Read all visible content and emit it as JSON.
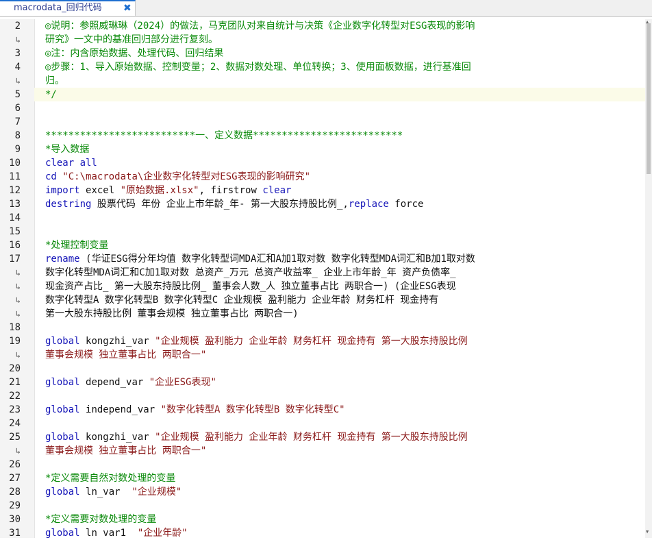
{
  "tab": {
    "title": "macrodata_回归代码",
    "close": "✖"
  },
  "lines": [
    {
      "no": "2",
      "parts": [
        {
          "t": "c",
          "v": "◎说明：参照威琳琳（2024）的做法，马克团队对来自统计与决策《企业数字化转型对ESG表现的影响"
        }
      ]
    },
    {
      "no": "↳",
      "wrap": true,
      "parts": [
        {
          "t": "c",
          "v": "研究》一文中的基准回归部分进行复刻。"
        }
      ]
    },
    {
      "no": "3",
      "parts": [
        {
          "t": "c",
          "v": "◎注：内含原始数据、处理代码、回归结果"
        }
      ]
    },
    {
      "no": "4",
      "parts": [
        {
          "t": "c",
          "v": "◎步骤：1、导入原始数据、控制变量；2、数据对数处理、单位转换；3、使用面板数据，进行基准回"
        }
      ]
    },
    {
      "no": "↳",
      "wrap": true,
      "parts": [
        {
          "t": "c",
          "v": "归。"
        }
      ]
    },
    {
      "no": "5",
      "parts": [
        {
          "t": "c",
          "v": "*/"
        }
      ]
    },
    {
      "no": "6",
      "parts": []
    },
    {
      "no": "7",
      "parts": []
    },
    {
      "no": "8",
      "parts": [
        {
          "t": "c",
          "v": "**************************一、定义数据**************************"
        }
      ]
    },
    {
      "no": "9",
      "parts": [
        {
          "t": "c",
          "v": "*导入数据"
        }
      ]
    },
    {
      "no": "10",
      "parts": [
        {
          "t": "k",
          "v": "clear all"
        }
      ]
    },
    {
      "no": "11",
      "parts": [
        {
          "t": "k",
          "v": "cd "
        },
        {
          "t": "s",
          "v": "\"C:\\macrodata\\企业数字化转型对ESG表现的影响研究\""
        }
      ]
    },
    {
      "no": "12",
      "parts": [
        {
          "t": "k",
          "v": "import "
        },
        {
          "t": "n",
          "v": "excel "
        },
        {
          "t": "s",
          "v": "\"原始数据.xlsx\""
        },
        {
          "t": "n",
          "v": ", firstrow "
        },
        {
          "t": "k",
          "v": "clear"
        }
      ]
    },
    {
      "no": "13",
      "parts": [
        {
          "t": "k",
          "v": "destring "
        },
        {
          "t": "n",
          "v": "股票代码 年份 企业上市年龄_年- 第一大股东持股比例_,"
        },
        {
          "t": "k",
          "v": "replace"
        },
        {
          "t": "n",
          "v": " force"
        }
      ]
    },
    {
      "no": "14",
      "parts": []
    },
    {
      "no": "15",
      "parts": []
    },
    {
      "no": "16",
      "parts": [
        {
          "t": "c",
          "v": "*处理控制变量"
        }
      ]
    },
    {
      "no": "17",
      "parts": [
        {
          "t": "k",
          "v": "rename "
        },
        {
          "t": "n",
          "v": "(华证ESG得分年均值 数字化转型词MDA汇和A加1取对数 数字化转型MDA词汇和B加1取对数"
        }
      ]
    },
    {
      "no": "↳",
      "wrap": true,
      "parts": [
        {
          "t": "n",
          "v": "数字化转型MDA词汇和C加1取对数 总资产_万元 总资产收益率_ 企业上市年龄_年 资产负债率_"
        }
      ]
    },
    {
      "no": "↳",
      "wrap": true,
      "parts": [
        {
          "t": "n",
          "v": "现金资产占比_ 第一大股东持股比例_ 董事会人数_人 独立董事占比 两职合一) (企业ESG表现"
        }
      ]
    },
    {
      "no": "↳",
      "wrap": true,
      "parts": [
        {
          "t": "n",
          "v": "数字化转型A 数字化转型B 数字化转型C 企业规模 盈利能力 企业年龄 财务杠杆 现金持有"
        }
      ]
    },
    {
      "no": "↳",
      "wrap": true,
      "parts": [
        {
          "t": "n",
          "v": "第一大股东持股比例 董事会规模 独立董事占比 两职合一)"
        }
      ]
    },
    {
      "no": "18",
      "parts": []
    },
    {
      "no": "19",
      "parts": [
        {
          "t": "k",
          "v": "global "
        },
        {
          "t": "n",
          "v": "kongzhi_var "
        },
        {
          "t": "s",
          "v": "\"企业规模 盈利能力 企业年龄 财务杠杆 现金持有 第一大股东持股比例"
        }
      ]
    },
    {
      "no": "↳",
      "wrap": true,
      "parts": [
        {
          "t": "s",
          "v": "董事会规模 独立董事占比 两职合一\""
        }
      ]
    },
    {
      "no": "20",
      "parts": []
    },
    {
      "no": "21",
      "parts": [
        {
          "t": "k",
          "v": "global "
        },
        {
          "t": "n",
          "v": "depend_var "
        },
        {
          "t": "s",
          "v": "\"企业ESG表现\""
        }
      ]
    },
    {
      "no": "22",
      "parts": []
    },
    {
      "no": "23",
      "parts": [
        {
          "t": "k",
          "v": "global "
        },
        {
          "t": "n",
          "v": "independ_var "
        },
        {
          "t": "s",
          "v": "\"数字化转型A 数字化转型B 数字化转型C\""
        }
      ]
    },
    {
      "no": "24",
      "parts": []
    },
    {
      "no": "25",
      "parts": [
        {
          "t": "k",
          "v": "global "
        },
        {
          "t": "n",
          "v": "kongzhi_var "
        },
        {
          "t": "s",
          "v": "\"企业规模 盈利能力 企业年龄 财务杠杆 现金持有 第一大股东持股比例"
        }
      ]
    },
    {
      "no": "↳",
      "wrap": true,
      "parts": [
        {
          "t": "s",
          "v": "董事会规模 独立董事占比 两职合一\""
        }
      ]
    },
    {
      "no": "26",
      "parts": []
    },
    {
      "no": "27",
      "parts": [
        {
          "t": "c",
          "v": "*定义需要自然对数处理的变量"
        }
      ]
    },
    {
      "no": "28",
      "parts": [
        {
          "t": "k",
          "v": "global "
        },
        {
          "t": "n",
          "v": "ln_var  "
        },
        {
          "t": "s",
          "v": "\"企业规模\""
        }
      ]
    },
    {
      "no": "29",
      "parts": []
    },
    {
      "no": "30",
      "parts": [
        {
          "t": "c",
          "v": "*定义需要对数处理的变量"
        }
      ]
    },
    {
      "no": "31",
      "parts": [
        {
          "t": "k",
          "v": "global "
        },
        {
          "t": "n",
          "v": "ln_var1  "
        },
        {
          "t": "s",
          "v": "\"企业年龄\""
        }
      ]
    }
  ]
}
